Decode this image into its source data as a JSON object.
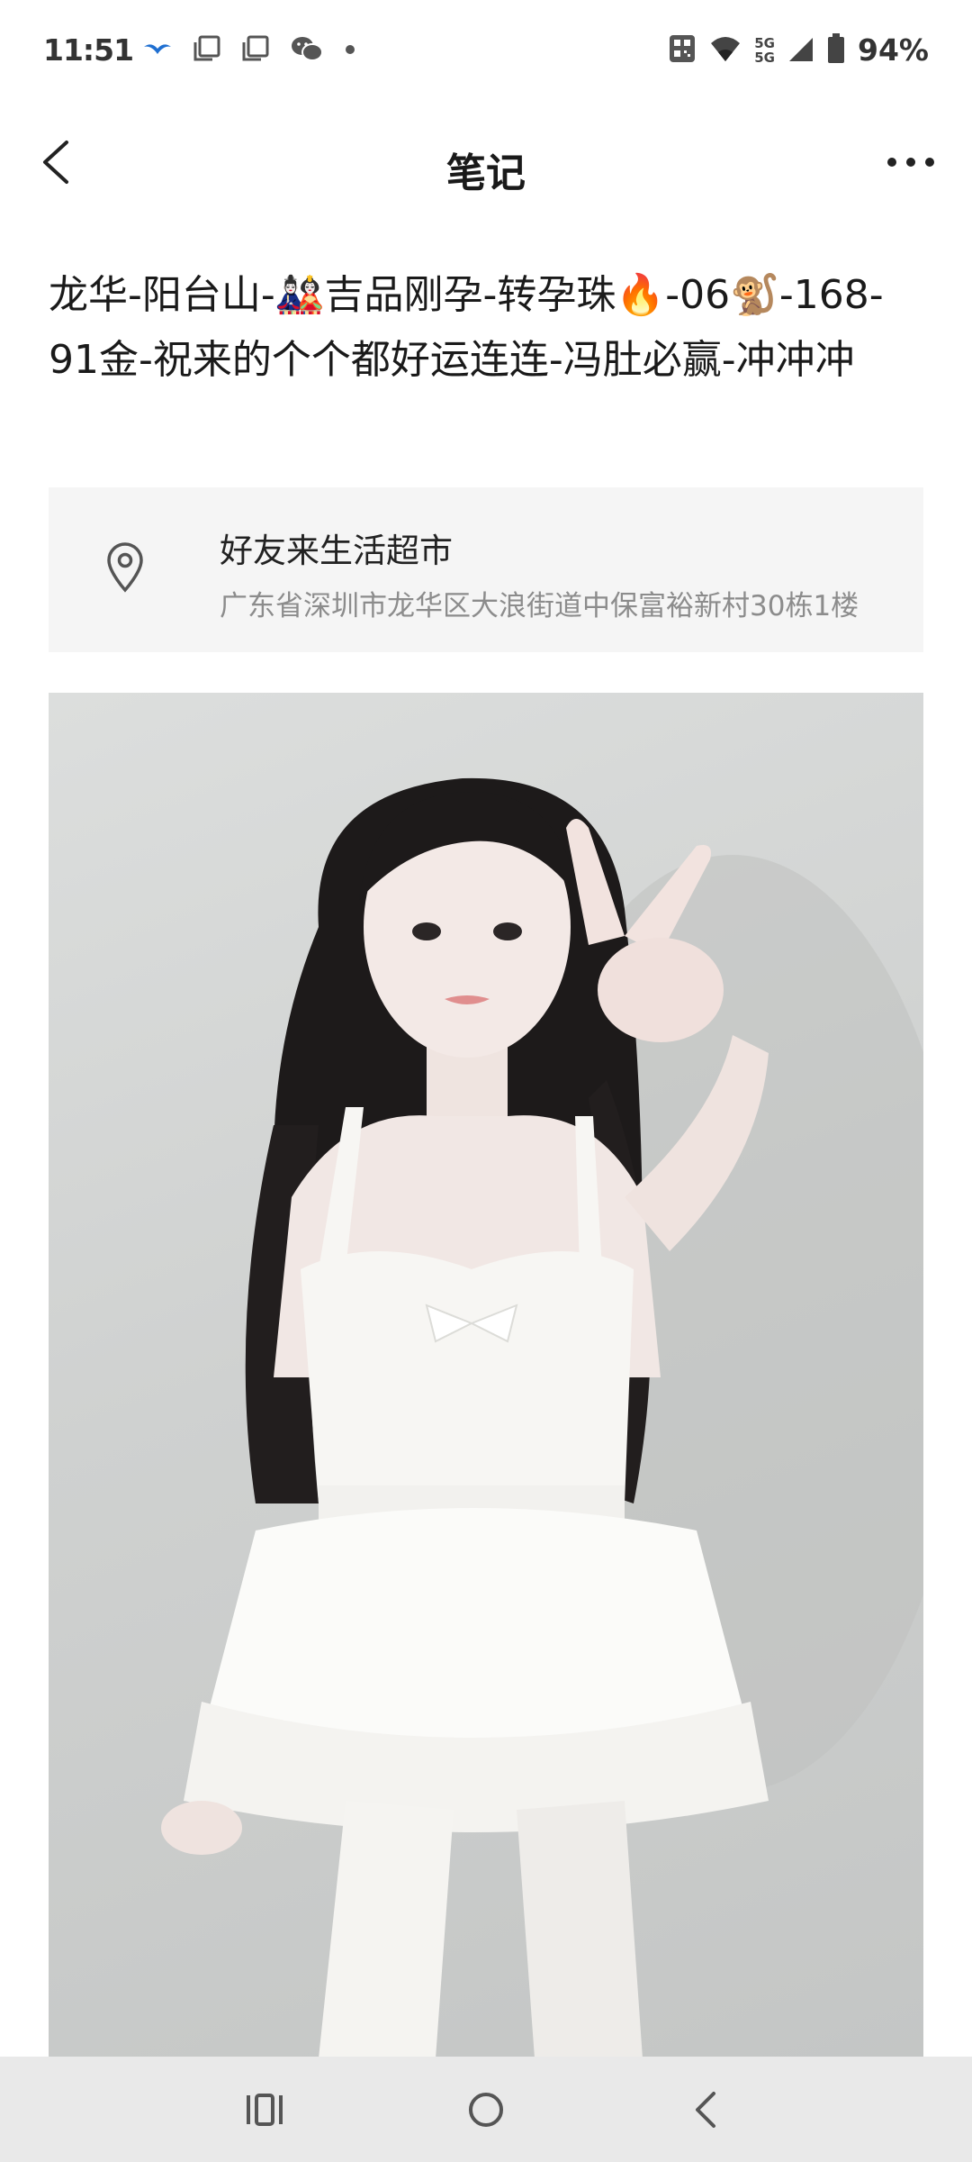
{
  "status_bar": {
    "time": "11:51",
    "battery": "94%",
    "network_top": "5G",
    "network_bottom": "5G",
    "icons": [
      "bird-app-icon",
      "square-notification-icon",
      "square-notification-icon",
      "wechat-icon",
      "dot-icon",
      "qr-icon",
      "wifi-icon",
      "signal-icon",
      "battery-icon"
    ]
  },
  "nav": {
    "title": "笔记",
    "back_icon": "chevron-left-icon",
    "more_icon": "more-horizontal-icon"
  },
  "note": {
    "title": "龙华-阳台山-🎎吉品刚孕-转孕珠🔥-06🐒-168-91金-祝来的个个都好运连连-冯肚必赢-冲冲冲"
  },
  "location": {
    "icon": "map-pin-icon",
    "name": "好友来生活超市",
    "address": "广东省深圳市龙华区大浪街道中保富裕新村30栋1楼"
  },
  "photo": {
    "subject": "portrait-photo"
  },
  "system_nav": {
    "icons": [
      "recent-apps-icon",
      "home-icon",
      "back-icon"
    ]
  }
}
